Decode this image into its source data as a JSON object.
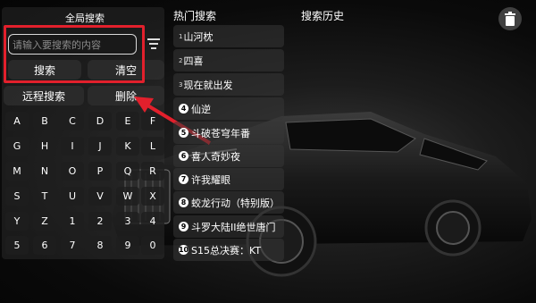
{
  "left_panel": {
    "title": "全局搜索",
    "input_placeholder": "请输入要搜索的内容",
    "search_label": "搜索",
    "clear_label": "清空",
    "remote_label": "远程搜索",
    "delete_label": "删除"
  },
  "keyboard": {
    "rows": [
      [
        "A",
        "B",
        "C",
        "D",
        "E",
        "F"
      ],
      [
        "G",
        "H",
        "I",
        "J",
        "K",
        "L"
      ],
      [
        "M",
        "N",
        "O",
        "P",
        "Q",
        "R"
      ],
      [
        "S",
        "T",
        "U",
        "V",
        "W",
        "X"
      ],
      [
        "Y",
        "Z",
        "1",
        "2",
        "3",
        "4"
      ],
      [
        "5",
        "6",
        "7",
        "8",
        "9",
        "0"
      ]
    ]
  },
  "hot": {
    "title": "热门搜索",
    "items": [
      {
        "rank": "1",
        "label": "山河枕"
      },
      {
        "rank": "2",
        "label": "四喜"
      },
      {
        "rank": "3",
        "label": "现在就出发"
      },
      {
        "rank": "4",
        "label": "仙逆"
      },
      {
        "rank": "5",
        "label": "斗破苍穹年番"
      },
      {
        "rank": "6",
        "label": "喜人奇妙夜"
      },
      {
        "rank": "7",
        "label": "许我耀眼"
      },
      {
        "rank": "8",
        "label": "蛟龙行动（特别版）"
      },
      {
        "rank": "9",
        "label": "斗罗大陆II绝世唐门"
      },
      {
        "rank": "10",
        "label": "S15总决赛：KT"
      }
    ]
  },
  "history": {
    "title": "搜索历史"
  },
  "icons": {
    "trash": "trash-icon",
    "filter": "filter-icon",
    "arrow": "red-arrow"
  },
  "colors": {
    "highlight": "#e2202c"
  }
}
